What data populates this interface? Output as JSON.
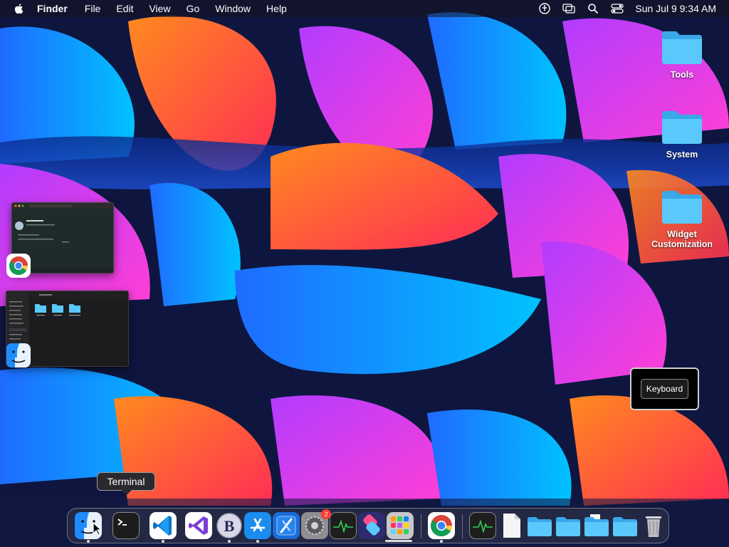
{
  "menubar": {
    "app_name": "Finder",
    "menus": [
      "File",
      "Edit",
      "View",
      "Go",
      "Window",
      "Help"
    ],
    "status_icons": [
      "accessibility-icon",
      "screen-mirroring-icon",
      "spotlight-search-icon",
      "control-center-icon"
    ],
    "clock": "Sun Jul 9  9:34 AM"
  },
  "desktop": {
    "icons": [
      {
        "label": "Tools",
        "icon": "folder-icon"
      },
      {
        "label": "System",
        "icon": "folder-icon"
      },
      {
        "label": "Widget Customization",
        "icon": "folder-icon"
      }
    ]
  },
  "stage_manager": {
    "windows": [
      {
        "app": "Google Chrome",
        "app_icon": "chrome-icon",
        "preview": "terminal-like dark window"
      },
      {
        "app": "Finder",
        "app_icon": "finder-icon",
        "preview": "finder window with folders"
      }
    ]
  },
  "keyboard_hud": {
    "label": "Keyboard"
  },
  "dock": {
    "tooltip": "Terminal",
    "items": [
      {
        "name": "Finder",
        "icon": "finder-icon",
        "running": true
      },
      {
        "name": "Terminal",
        "icon": "terminal-icon",
        "running": false
      },
      {
        "name": "Visual Studio Code",
        "icon": "vscode-icon",
        "running": true
      },
      {
        "name": "Visual Studio",
        "icon": "visual-studio-icon",
        "running": false
      },
      {
        "name": "BBEdit",
        "icon": "bbedit-icon",
        "running": true
      },
      {
        "name": "App Store",
        "icon": "app-store-icon",
        "running": true
      },
      {
        "name": "Xcode",
        "icon": "xcode-icon",
        "running": false
      },
      {
        "name": "System Settings",
        "icon": "system-settings-icon",
        "running": false,
        "badge": "2"
      },
      {
        "name": "Activity Monitor",
        "icon": "activity-monitor-icon",
        "running": false
      },
      {
        "name": "Shortcuts",
        "icon": "shortcuts-icon",
        "running": false
      },
      {
        "name": "Launchpad",
        "icon": "launchpad-icon",
        "running": true
      },
      {
        "name": "Google Chrome",
        "icon": "chrome-icon",
        "running": true
      },
      {
        "name": "Activity Monitor",
        "icon": "activity-monitor-icon",
        "running": false
      },
      {
        "name": "Document",
        "icon": "document-icon",
        "running": false
      },
      {
        "name": "Folder",
        "icon": "folder-icon",
        "running": false
      },
      {
        "name": "Folder",
        "icon": "folder-icon",
        "running": false
      },
      {
        "name": "Folder",
        "icon": "folder-icon",
        "running": false
      },
      {
        "name": "Folder",
        "icon": "folder-icon",
        "running": false
      },
      {
        "name": "Trash",
        "icon": "trash-icon",
        "running": false
      }
    ]
  },
  "colors": {
    "menubar_bg": "#141420",
    "dock_border": "#ffffff",
    "badge_red": "#ff3b30",
    "folder_blue": "#5ac8fa"
  }
}
